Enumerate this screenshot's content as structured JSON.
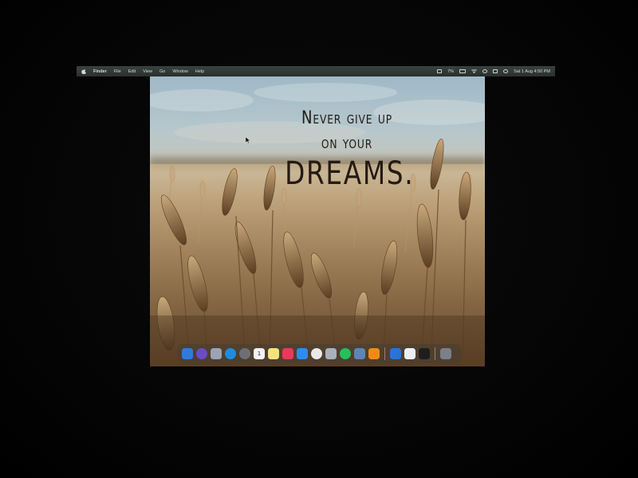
{
  "menubar": {
    "app_name": "Finder",
    "items": [
      "File",
      "Edit",
      "View",
      "Go",
      "Window",
      "Help"
    ],
    "status": {
      "battery_percent": "7%",
      "clock": "Sat 1 Aug  4:50 PM"
    }
  },
  "wallpaper": {
    "quote_line1": "Never give up",
    "quote_line2": "on your",
    "quote_line3": "DREAMS."
  },
  "dock": {
    "apps": [
      {
        "name": "finder-icon",
        "color": "#2f7bdc"
      },
      {
        "name": "siri-icon",
        "color": "#6a4cc7"
      },
      {
        "name": "launchpad-icon",
        "color": "#9aa3b4"
      },
      {
        "name": "safari-icon",
        "color": "#1f8be0"
      },
      {
        "name": "system-preferences-icon",
        "color": "#6d7176"
      },
      {
        "name": "calendar-icon",
        "color": "#f2f2f2",
        "text": "1"
      },
      {
        "name": "notes-icon",
        "color": "#f6e27c"
      },
      {
        "name": "music-icon",
        "color": "#f0375a"
      },
      {
        "name": "mail-icon",
        "color": "#2d8cf0"
      },
      {
        "name": "chrome-icon",
        "color": "#e9e9e9"
      },
      {
        "name": "screenshot-icon",
        "color": "#a8b1bd"
      },
      {
        "name": "whatsapp-icon",
        "color": "#25c15a"
      },
      {
        "name": "preview-icon",
        "color": "#5d85b8"
      },
      {
        "name": "vlc-icon",
        "color": "#f28a16"
      },
      {
        "name": "xcode-icon",
        "color": "#2a73d8"
      },
      {
        "name": "textedit-icon",
        "color": "#eceff3"
      },
      {
        "name": "terminal-icon",
        "color": "#1e1e1e"
      },
      {
        "name": "trash-icon",
        "color": "#7b8089"
      }
    ]
  }
}
